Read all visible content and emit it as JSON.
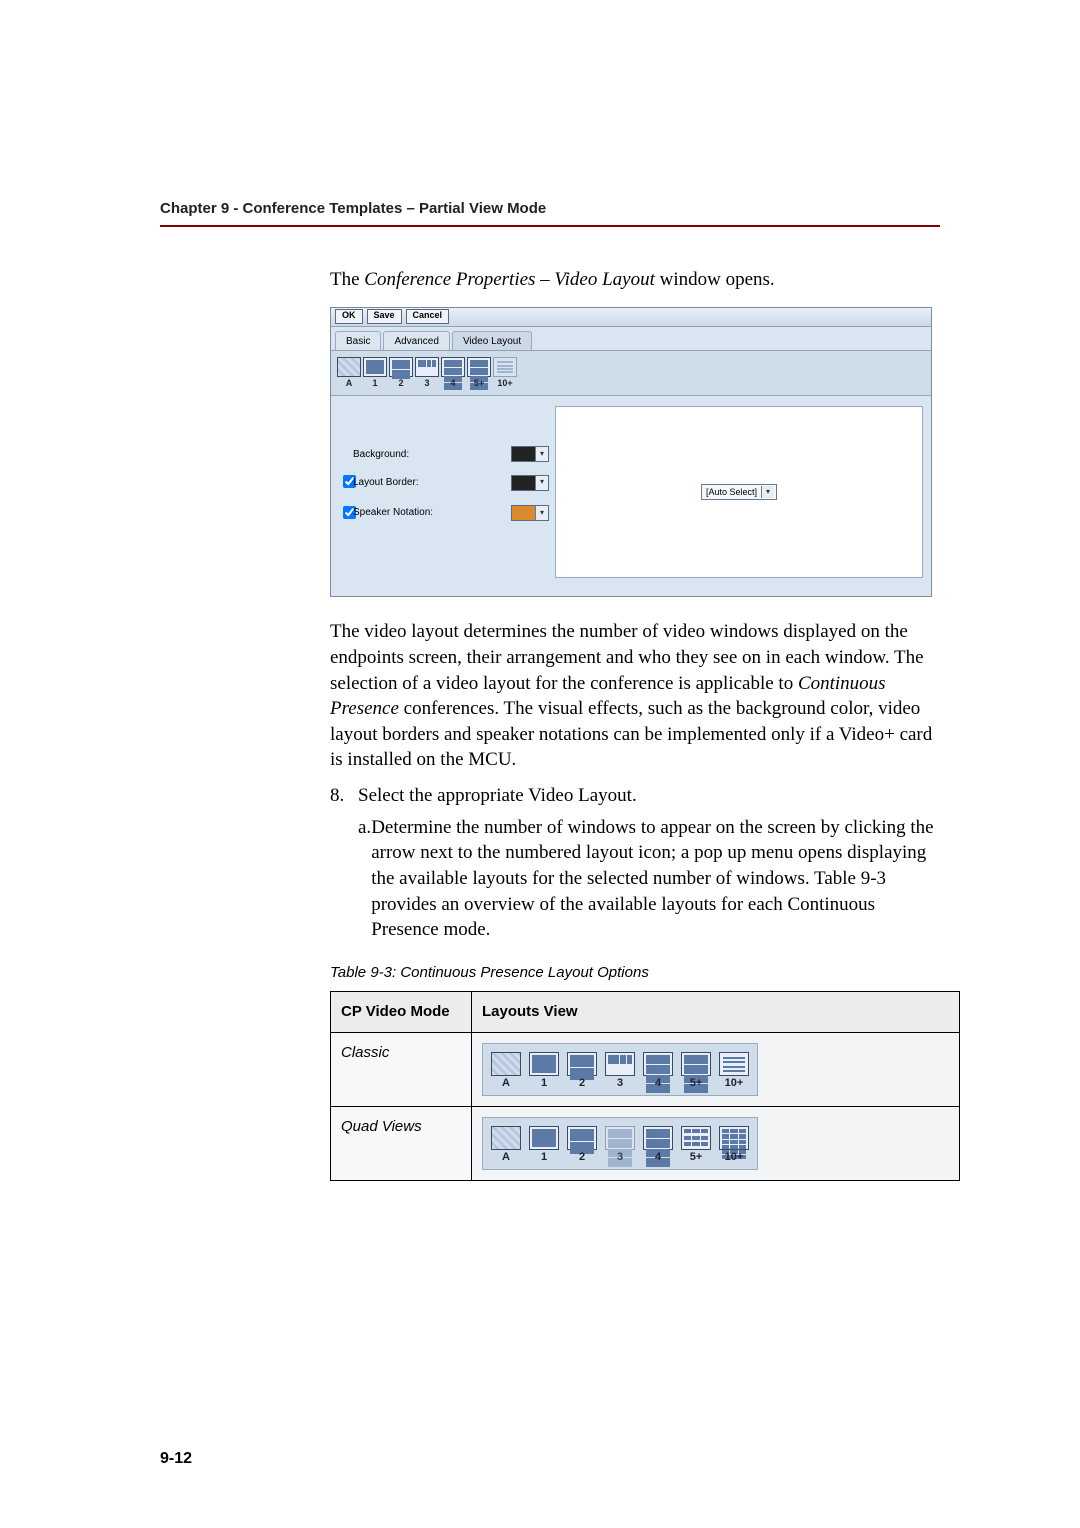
{
  "header": {
    "running": "Chapter 9 - Conference Templates – Partial View Mode"
  },
  "intro": {
    "pre": "The ",
    "ital": "Conference Properties – Video Layout",
    "post": " window opens."
  },
  "screenshot": {
    "buttons": {
      "ok": "OK",
      "save": "Save",
      "cancel": "Cancel"
    },
    "tabs": {
      "basic": "Basic",
      "advanced": "Advanced",
      "video": "Video Layout"
    },
    "layout_labels": [
      "A",
      "1",
      "2",
      "3",
      "4",
      "5+",
      "10+"
    ],
    "form": {
      "background": "Background:",
      "border": "Layout Border:",
      "speaker": "Speaker Notation:"
    },
    "auto_select": "[Auto Select]"
  },
  "prose": {
    "para_layout_explain_a": "The video layout determines the number of video windows displayed on the endpoints screen, their arrangement and who they see on in each window. The selection of a video layout for the conference is applicable to ",
    "para_layout_explain_ital": "Continuous Presence",
    "para_layout_explain_b": " conferences. The visual effects, such as the background color, video layout borders and speaker notations can be implemented only if a Video+ card is installed on the MCU.",
    "step8_num": "8.",
    "step8_text_a": "Select the appropriate ",
    "step8_ital": "Video Layout",
    "step8_text_b": ".",
    "step8a_let": "a.",
    "step8a_text": "Determine the number of windows to appear on the screen by clicking the arrow next to the numbered layout icon; a pop up menu opens displaying the available layouts for the selected number of windows. Table 9-3 provides an overview of the available layouts for each Continuous Presence mode."
  },
  "table": {
    "caption": "Table 9-3: Continuous Presence Layout Options",
    "head_mode": "CP Video Mode",
    "head_view": "Layouts View",
    "rows": [
      {
        "mode": "Classic",
        "labels": [
          "A",
          "1",
          "2",
          "3",
          "4",
          "5+",
          "10+"
        ]
      },
      {
        "mode": "Quad Views",
        "labels": [
          "A",
          "1",
          "2",
          "3",
          "4",
          "5+",
          "10+"
        ]
      }
    ]
  },
  "page_number": "9-12"
}
